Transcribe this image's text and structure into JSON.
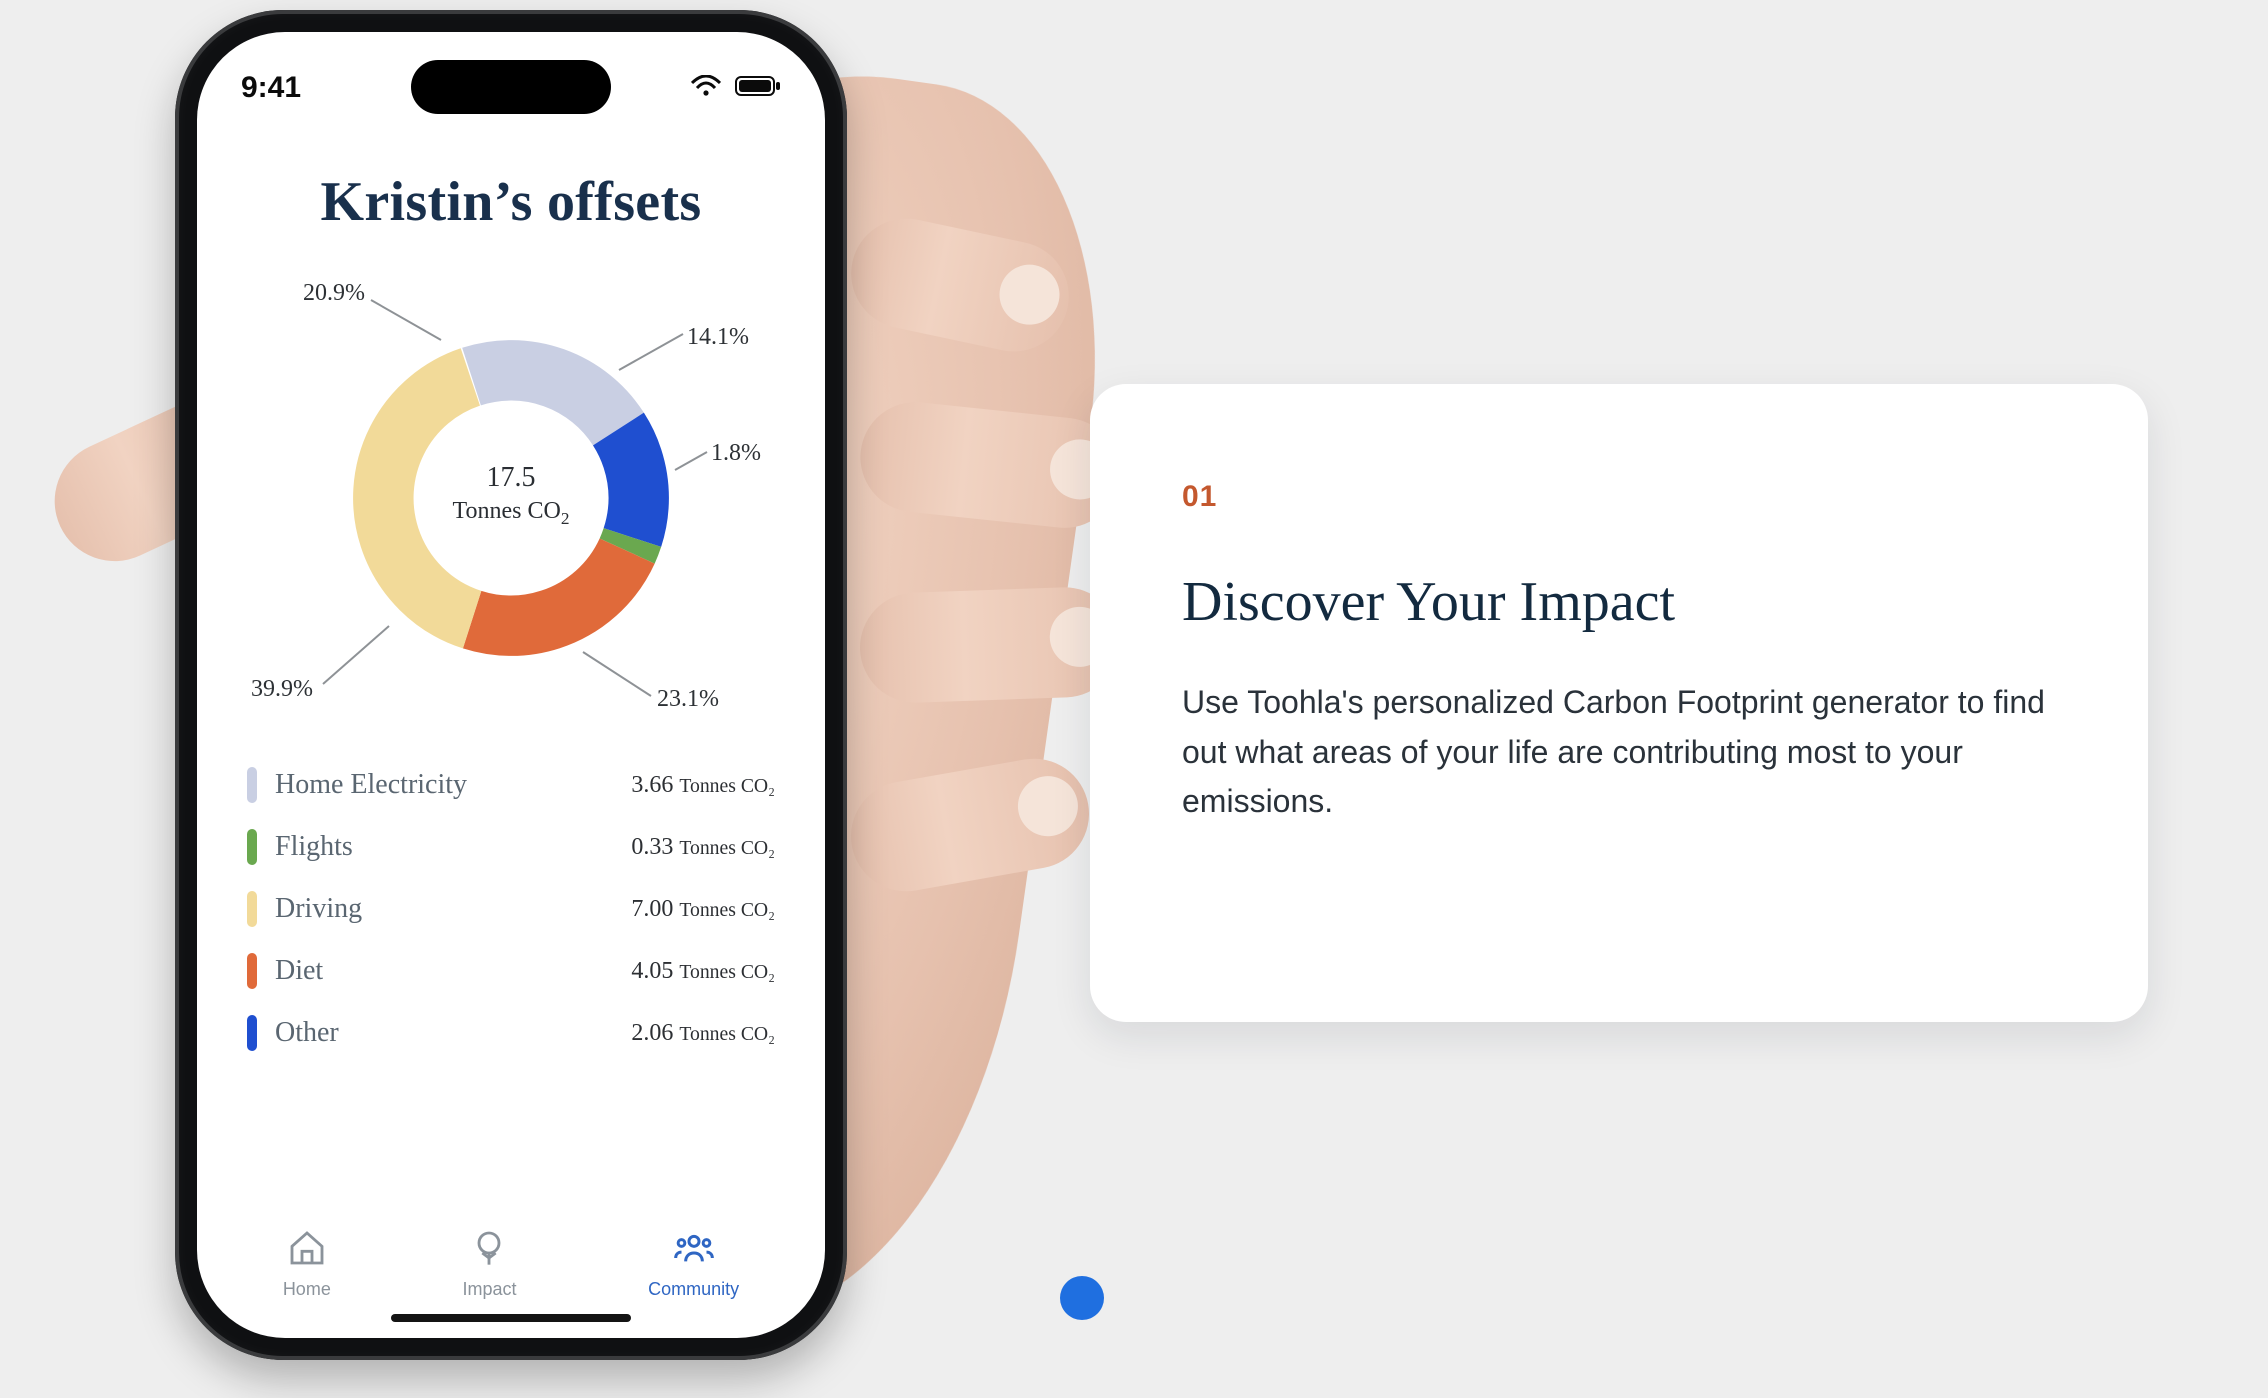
{
  "status": {
    "time": "9:41"
  },
  "phone": {
    "title": "Kristin’s offsets",
    "center": {
      "value": "17.5",
      "unitHtml": "Tonnes CO"
    },
    "slices": {
      "home_electricity": {
        "pct": "20.9%",
        "color": "#c9cfe3"
      },
      "driving": {
        "pct": "39.9%",
        "color": "#f2da99"
      },
      "diet": {
        "pct": "23.1%",
        "color": "#e06a3a"
      },
      "flights": {
        "pct": "1.8%",
        "color": "#6aa84f"
      },
      "other": {
        "pct": "14.1%",
        "color": "#1f4fd0"
      }
    },
    "legend": [
      {
        "name": "Home Electricity",
        "value": "3.66",
        "unit": "Tonnes CO₂",
        "color": "#c9cfe3"
      },
      {
        "name": "Flights",
        "value": "0.33",
        "unit": "Tonnes CO₂",
        "color": "#6aa84f"
      },
      {
        "name": "Driving",
        "value": "7.00",
        "unit": "Tonnes CO₂",
        "color": "#f2da99"
      },
      {
        "name": "Diet",
        "value": "4.05",
        "unit": "Tonnes CO₂",
        "color": "#e06a3a"
      },
      {
        "name": "Other",
        "value": "2.06",
        "unit": "Tonnes CO₂",
        "color": "#1f4fd0"
      }
    ],
    "tabs": {
      "home": "Home",
      "impact": "Impact",
      "community": "Community"
    }
  },
  "card": {
    "index": "01",
    "title": "Discover Your Impact",
    "body": "Use Toohla's personalized Carbon Footprint generator to find out what areas of your life are contributing most to your emissions."
  },
  "chart_data": {
    "type": "pie",
    "title": "Kristin’s offsets",
    "unit": "Tonnes CO₂",
    "total": 17.5,
    "series": [
      {
        "name": "Home Electricity",
        "value": 3.66,
        "pct": 20.9,
        "color": "#c9cfe3"
      },
      {
        "name": "Flights",
        "value": 0.33,
        "pct": 1.8,
        "color": "#6aa84f"
      },
      {
        "name": "Driving",
        "value": 7.0,
        "pct": 39.9,
        "color": "#f2da99"
      },
      {
        "name": "Diet",
        "value": 4.05,
        "pct": 23.1,
        "color": "#e06a3a"
      },
      {
        "name": "Other",
        "value": 2.06,
        "pct": 14.1,
        "color": "#1f4fd0"
      }
    ]
  }
}
